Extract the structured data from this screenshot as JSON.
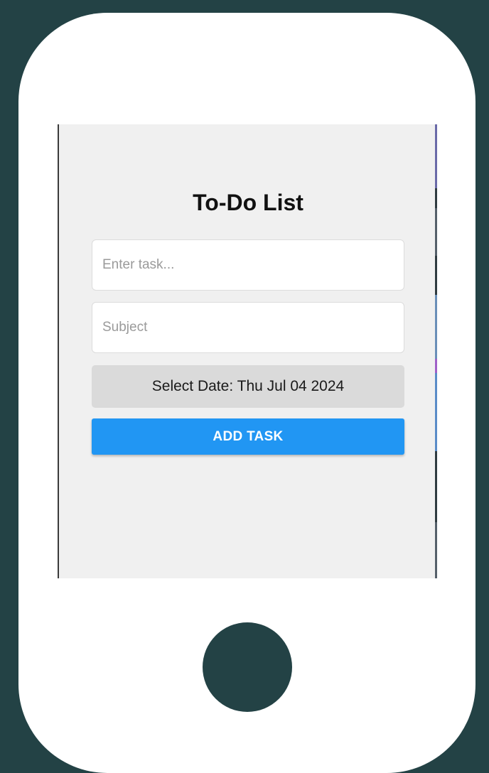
{
  "app": {
    "title": "To-Do List"
  },
  "form": {
    "task_placeholder": "Enter task...",
    "task_value": "",
    "subject_placeholder": "Subject",
    "subject_value": "",
    "date_label": "Select Date: Thu Jul 04 2024",
    "add_label": "ADD TASK"
  },
  "colors": {
    "background": "#234245",
    "frame": "#ffffff",
    "screen": "#f0f0f0",
    "accent": "#2196f3",
    "date_button": "#dadada"
  }
}
